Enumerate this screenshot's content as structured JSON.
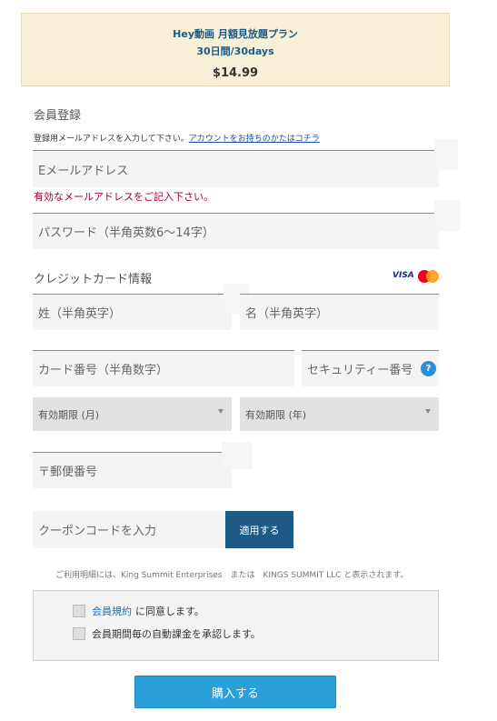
{
  "plan": {
    "name": "Hey動画 月額見放題プラン",
    "period": "30日間/30days",
    "price": "$14.99"
  },
  "registration": {
    "title": "会員登録",
    "helper_text": "登録用メールアドレスを入力して下さい。",
    "helper_link": "アカウントをお持ちのかたはコチラ",
    "email_placeholder": "Eメールアドレス",
    "email_error": "有効なメールアドレスをご記入下さい。",
    "password_placeholder": "パスワード（半角英数6〜14字）"
  },
  "credit_card": {
    "title": "クレジットカード情報",
    "visa_label": "VISA",
    "last_name_placeholder": "姓（半角英字）",
    "first_name_placeholder": "名（半角英字）",
    "card_number_placeholder": "カード番号（半角数字）",
    "security_code_placeholder": "セキュリティー番号",
    "help_icon": "?",
    "expiry_month": "有効期限 (月)",
    "expiry_year": "有効期限 (年)",
    "postal_code_placeholder": "〒郵便番号",
    "brand_colors": {
      "mastercard_red": "#eb001b",
      "mastercard_orange": "#f79e1b"
    }
  },
  "coupon": {
    "placeholder": "クーポンコードを入力",
    "apply_label": "適用する"
  },
  "billing_notice": "ご利用明細には、King Summit Enterprises　または　KINGS SUMMIT LLC と表示されます。",
  "agreements": {
    "terms_link": "会員規約",
    "terms_suffix": "に同意します。",
    "autobill_text": "会員期間毎の自動課金を承認します。"
  },
  "purchase_label": "購入する",
  "colors": {
    "accent": "#1d5a86",
    "purchase": "#2a9fd8",
    "error": "#a40032",
    "plan_bg": "#f7efd6"
  }
}
